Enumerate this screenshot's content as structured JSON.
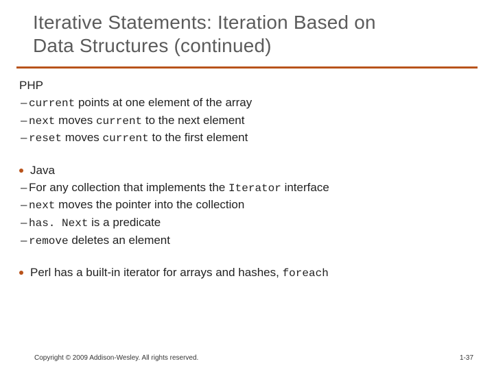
{
  "title_line1": "Iterative Statements: Iteration Based on",
  "title_line2": "Data Structures (continued)",
  "section_php": {
    "heading": "PHP",
    "items": [
      {
        "code1": "current",
        "tail1": " points at one element of the array"
      },
      {
        "code1": "next",
        "mid1": " moves ",
        "code2": "current",
        "tail2": " to the next element"
      },
      {
        "code1": "reset",
        "mid1": " moves ",
        "code2": "current",
        "tail2": " to the first element"
      }
    ]
  },
  "section_java": {
    "heading": "Java",
    "items": [
      {
        "pre": "For any collection that implements the ",
        "code1": "Iterator",
        "tail1": " interface"
      },
      {
        "code1": "next",
        "tail1": " moves the pointer into the collection"
      },
      {
        "code1": "has. Next",
        "tail1": " is a predicate"
      },
      {
        "code1": "remove",
        "tail1": " deletes an element"
      }
    ]
  },
  "section_perl": {
    "pre": "Perl has a built-in iterator for arrays and hashes, ",
    "code1": "foreach"
  },
  "footer": {
    "copyright": "Copyright © 2009 Addison-Wesley. All rights reserved.",
    "pagenum": "1-37"
  }
}
